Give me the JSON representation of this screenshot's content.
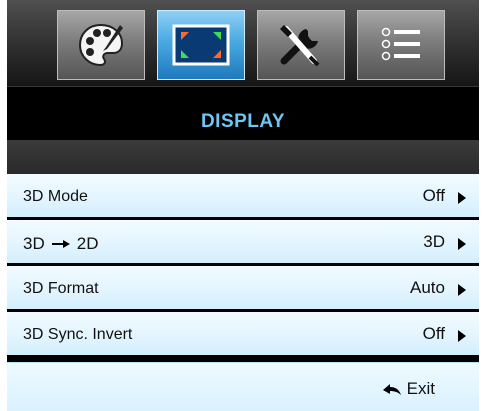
{
  "tabs": [
    {
      "icon": "palette-icon",
      "active": false
    },
    {
      "icon": "display-icon",
      "active": true
    },
    {
      "icon": "tools-icon",
      "active": false
    },
    {
      "icon": "list-icon",
      "active": false
    }
  ],
  "title": "DISPLAY",
  "rows": [
    {
      "label": "3D Mode",
      "value": "Off"
    },
    {
      "label_left": "3D",
      "label_right": "2D",
      "value": "3D"
    },
    {
      "label": "3D Format",
      "value": "Auto"
    },
    {
      "label": "3D Sync. Invert",
      "value": "Off"
    }
  ],
  "exit_label": "Exit",
  "colors": {
    "title": "#6ec6f2",
    "active_tab": "#4aa9e1",
    "row_bg": "#e3f5ff"
  }
}
